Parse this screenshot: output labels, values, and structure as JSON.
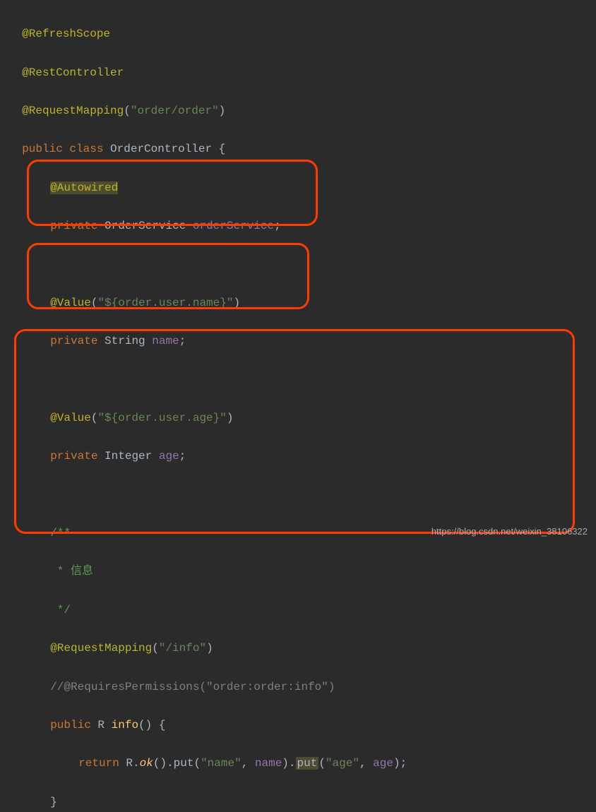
{
  "code": {
    "anno_refresh": "@RefreshScope",
    "anno_rest": "@RestController",
    "anno_reqmap": "@RequestMapping",
    "reqmap_val": "\"order/order\"",
    "kw_public": "public",
    "kw_class": "class",
    "classname": "OrderController",
    "brace_open": " {",
    "anno_autowired": "@Autowired",
    "kw_private": "private",
    "type_orderservice": "OrderService",
    "field_orderservice": "orderService",
    "semi": ";",
    "anno_value": "@Value",
    "value_name": "\"${order.user.name}\"",
    "type_string": "String",
    "field_name": "name",
    "value_age": "\"${order.user.age}\"",
    "type_integer": "Integer",
    "field_age": "age",
    "doc_start": "/**",
    "doc_line": " * 信息",
    "doc_end": " */",
    "reqmap_info": "\"/info\"",
    "comment_perm": "//@RequiresPermissions(\"order:order:info\")",
    "type_r": "R",
    "method_info": "info",
    "parens": "()",
    "kw_return": "return",
    "r_class": "R",
    "ok": "ok",
    "put": "put",
    "str_name": "\"name\"",
    "arg_name": "name",
    "str_age": "\"age\"",
    "arg_age": "age",
    "brace_close": "}"
  },
  "watermark": "https://blog.csdn.net/weixin_38106322"
}
